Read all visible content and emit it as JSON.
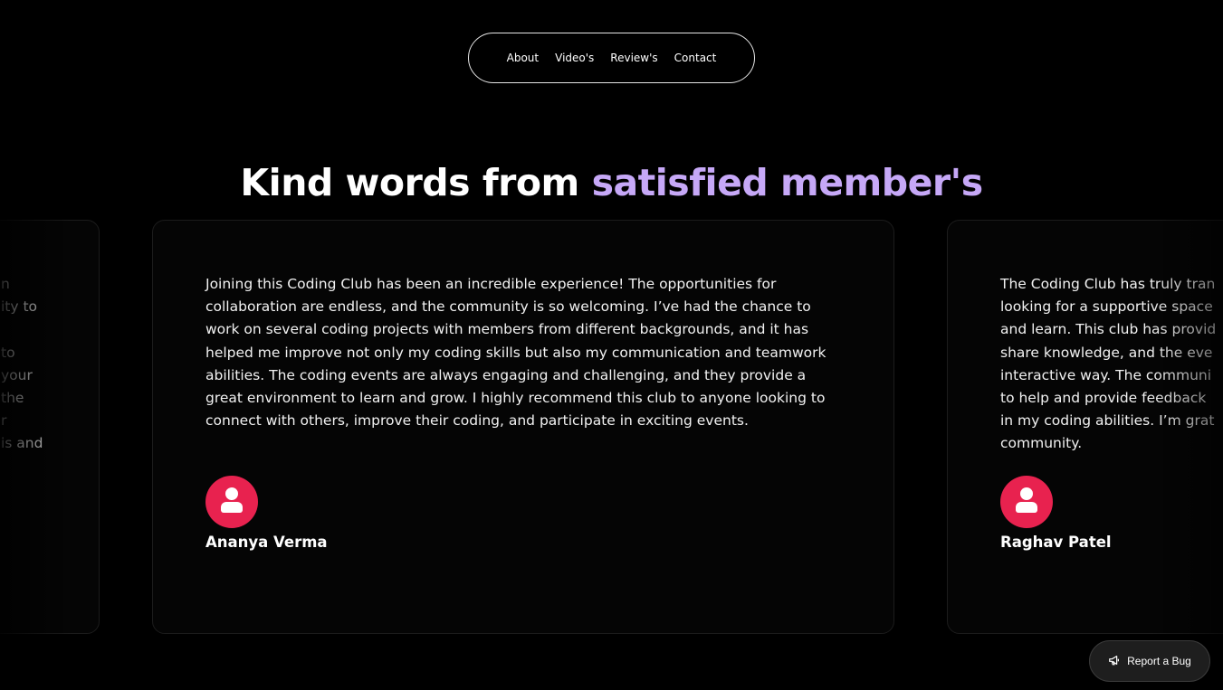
{
  "nav": {
    "items": [
      "About",
      "Video's",
      "Review's",
      "Contact"
    ]
  },
  "heading": {
    "prefix": "Kind words from ",
    "accent": "satisfied member's"
  },
  "reviews": {
    "left": {
      "quote_fragments": [
        "n",
        "ity to",
        "",
        "to",
        "your",
        "the",
        "r",
        "is and"
      ]
    },
    "center": {
      "quote": "Joining this Coding Club has been an incredible experience! The opportunities for collaboration are endless, and the community is so welcoming. I’ve had the chance to work on several coding projects with members from different backgrounds, and it has helped me improve not only my coding skills but also my communication and teamwork abilities. The coding events are always engaging and challenging, and they provide a great environment to learn and grow. I highly recommend this club to anyone looking to connect with others, improve their coding, and participate in exciting events.",
      "name": "Ananya Verma",
      "avatar_icon": "user-icon"
    },
    "right": {
      "quote": "The Coding Club has truly trans... looking for a supportive space... and learn. This club has provid... share knowledge, and the eve... interactive way. The communi... to help and provide feedback... in my coding abilities. I’m grat... community.",
      "lines": [
        "The Coding Club has truly tran",
        "looking for a supportive space",
        "and learn. This club has provid",
        "share knowledge, and the eve",
        "interactive way. The communi",
        "to help and provide feedback",
        "in my coding abilities. I’m grat",
        "community."
      ],
      "name": "Raghav Patel",
      "avatar_icon": "user-icon"
    }
  },
  "report_bug": {
    "label": "Report a Bug",
    "icon": "megaphone-icon"
  },
  "colors": {
    "background": "#000000",
    "accent": "#c6a8f7",
    "avatar": "#e8224f"
  }
}
